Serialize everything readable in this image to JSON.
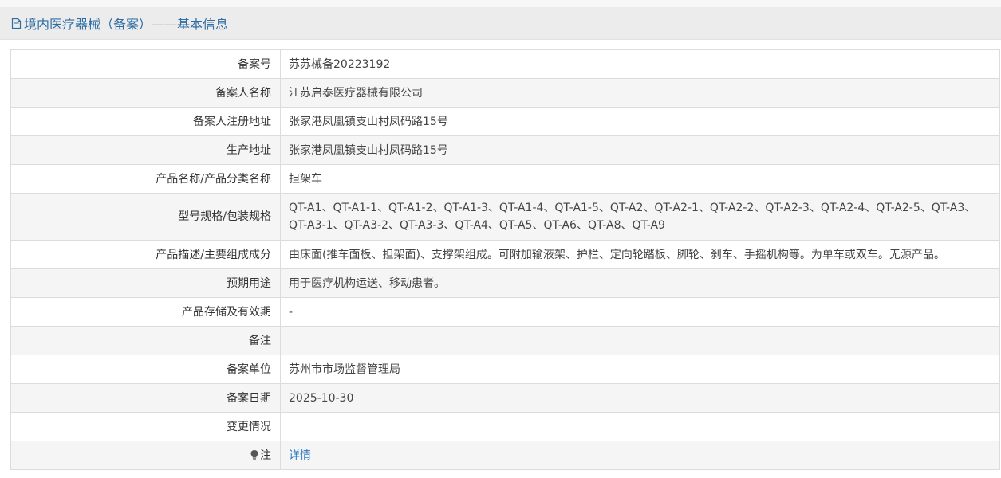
{
  "header": {
    "title": "境内医疗器械（备案）——基本信息",
    "icon": "document-icon"
  },
  "rows": [
    {
      "label": "备案号",
      "value": "苏苏械备20223192"
    },
    {
      "label": "备案人名称",
      "value": "江苏启泰医疗器械有限公司"
    },
    {
      "label": "备案人注册地址",
      "value": "张家港凤凰镇支山村凤码路15号"
    },
    {
      "label": "生产地址",
      "value": "张家港凤凰镇支山村凤码路15号"
    },
    {
      "label": "产品名称/产品分类名称",
      "value": "担架车"
    },
    {
      "label": "型号规格/包装规格",
      "value": "QT-A1、QT-A1-1、QT-A1-2、QT-A1-3、QT-A1-4、QT-A1-5、QT-A2、QT-A2-1、QT-A2-2、QT-A2-3、QT-A2-4、QT-A2-5、QT-A3、QT-A3-1、QT-A3-2、QT-A3-3、QT-A4、QT-A5、QT-A6、QT-A8、QT-A9"
    },
    {
      "label": "产品描述/主要组成成分",
      "value": "由床面(推车面板、担架面)、支撑架组成。可附加输液架、护栏、定向轮踏板、脚轮、刹车、手摇机构等。为单车或双车。无源产品。"
    },
    {
      "label": "预期用途",
      "value": "用于医疗机构运送、移动患者。"
    },
    {
      "label": "产品存储及有效期",
      "value": "-"
    },
    {
      "label": "备注",
      "value": ""
    },
    {
      "label": "备案单位",
      "value": "苏州市市场监督管理局"
    },
    {
      "label": "备案日期",
      "value": "2025-10-30"
    },
    {
      "label": "变更情况",
      "value": ""
    },
    {
      "label": "注",
      "value": "详情",
      "icon": "lightbulb-icon"
    }
  ],
  "colors": {
    "header_bg": "#ececec",
    "header_text": "#2e6da4",
    "link": "#2e7bbf",
    "alt_row": "#f5f5f5",
    "border": "#dcdcdc"
  }
}
